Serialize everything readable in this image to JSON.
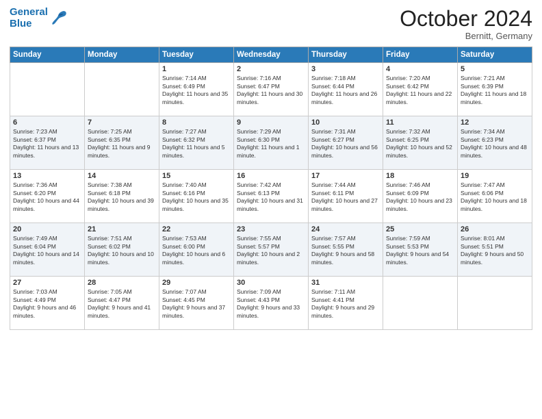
{
  "header": {
    "logo_line1": "General",
    "logo_line2": "Blue",
    "month": "October 2024",
    "location": "Bernitt, Germany"
  },
  "days_of_week": [
    "Sunday",
    "Monday",
    "Tuesday",
    "Wednesday",
    "Thursday",
    "Friday",
    "Saturday"
  ],
  "weeks": [
    [
      {
        "day": "",
        "info": ""
      },
      {
        "day": "",
        "info": ""
      },
      {
        "day": "1",
        "info": "Sunrise: 7:14 AM\nSunset: 6:49 PM\nDaylight: 11 hours and 35 minutes."
      },
      {
        "day": "2",
        "info": "Sunrise: 7:16 AM\nSunset: 6:47 PM\nDaylight: 11 hours and 30 minutes."
      },
      {
        "day": "3",
        "info": "Sunrise: 7:18 AM\nSunset: 6:44 PM\nDaylight: 11 hours and 26 minutes."
      },
      {
        "day": "4",
        "info": "Sunrise: 7:20 AM\nSunset: 6:42 PM\nDaylight: 11 hours and 22 minutes."
      },
      {
        "day": "5",
        "info": "Sunrise: 7:21 AM\nSunset: 6:39 PM\nDaylight: 11 hours and 18 minutes."
      }
    ],
    [
      {
        "day": "6",
        "info": "Sunrise: 7:23 AM\nSunset: 6:37 PM\nDaylight: 11 hours and 13 minutes."
      },
      {
        "day": "7",
        "info": "Sunrise: 7:25 AM\nSunset: 6:35 PM\nDaylight: 11 hours and 9 minutes."
      },
      {
        "day": "8",
        "info": "Sunrise: 7:27 AM\nSunset: 6:32 PM\nDaylight: 11 hours and 5 minutes."
      },
      {
        "day": "9",
        "info": "Sunrise: 7:29 AM\nSunset: 6:30 PM\nDaylight: 11 hours and 1 minute."
      },
      {
        "day": "10",
        "info": "Sunrise: 7:31 AM\nSunset: 6:27 PM\nDaylight: 10 hours and 56 minutes."
      },
      {
        "day": "11",
        "info": "Sunrise: 7:32 AM\nSunset: 6:25 PM\nDaylight: 10 hours and 52 minutes."
      },
      {
        "day": "12",
        "info": "Sunrise: 7:34 AM\nSunset: 6:23 PM\nDaylight: 10 hours and 48 minutes."
      }
    ],
    [
      {
        "day": "13",
        "info": "Sunrise: 7:36 AM\nSunset: 6:20 PM\nDaylight: 10 hours and 44 minutes."
      },
      {
        "day": "14",
        "info": "Sunrise: 7:38 AM\nSunset: 6:18 PM\nDaylight: 10 hours and 39 minutes."
      },
      {
        "day": "15",
        "info": "Sunrise: 7:40 AM\nSunset: 6:16 PM\nDaylight: 10 hours and 35 minutes."
      },
      {
        "day": "16",
        "info": "Sunrise: 7:42 AM\nSunset: 6:13 PM\nDaylight: 10 hours and 31 minutes."
      },
      {
        "day": "17",
        "info": "Sunrise: 7:44 AM\nSunset: 6:11 PM\nDaylight: 10 hours and 27 minutes."
      },
      {
        "day": "18",
        "info": "Sunrise: 7:46 AM\nSunset: 6:09 PM\nDaylight: 10 hours and 23 minutes."
      },
      {
        "day": "19",
        "info": "Sunrise: 7:47 AM\nSunset: 6:06 PM\nDaylight: 10 hours and 18 minutes."
      }
    ],
    [
      {
        "day": "20",
        "info": "Sunrise: 7:49 AM\nSunset: 6:04 PM\nDaylight: 10 hours and 14 minutes."
      },
      {
        "day": "21",
        "info": "Sunrise: 7:51 AM\nSunset: 6:02 PM\nDaylight: 10 hours and 10 minutes."
      },
      {
        "day": "22",
        "info": "Sunrise: 7:53 AM\nSunset: 6:00 PM\nDaylight: 10 hours and 6 minutes."
      },
      {
        "day": "23",
        "info": "Sunrise: 7:55 AM\nSunset: 5:57 PM\nDaylight: 10 hours and 2 minutes."
      },
      {
        "day": "24",
        "info": "Sunrise: 7:57 AM\nSunset: 5:55 PM\nDaylight: 9 hours and 58 minutes."
      },
      {
        "day": "25",
        "info": "Sunrise: 7:59 AM\nSunset: 5:53 PM\nDaylight: 9 hours and 54 minutes."
      },
      {
        "day": "26",
        "info": "Sunrise: 8:01 AM\nSunset: 5:51 PM\nDaylight: 9 hours and 50 minutes."
      }
    ],
    [
      {
        "day": "27",
        "info": "Sunrise: 7:03 AM\nSunset: 4:49 PM\nDaylight: 9 hours and 46 minutes."
      },
      {
        "day": "28",
        "info": "Sunrise: 7:05 AM\nSunset: 4:47 PM\nDaylight: 9 hours and 41 minutes."
      },
      {
        "day": "29",
        "info": "Sunrise: 7:07 AM\nSunset: 4:45 PM\nDaylight: 9 hours and 37 minutes."
      },
      {
        "day": "30",
        "info": "Sunrise: 7:09 AM\nSunset: 4:43 PM\nDaylight: 9 hours and 33 minutes."
      },
      {
        "day": "31",
        "info": "Sunrise: 7:11 AM\nSunset: 4:41 PM\nDaylight: 9 hours and 29 minutes."
      },
      {
        "day": "",
        "info": ""
      },
      {
        "day": "",
        "info": ""
      }
    ]
  ]
}
